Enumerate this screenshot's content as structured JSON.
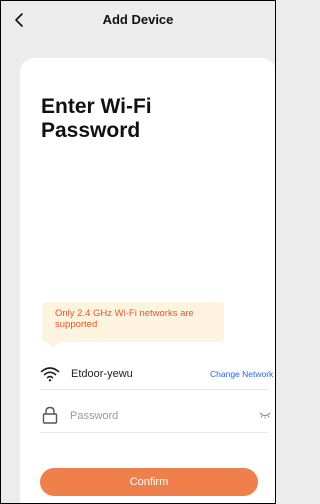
{
  "header": {
    "title": "Add Device",
    "back_icon": "chevron-left-icon"
  },
  "page": {
    "heading": "Enter Wi-Fi\nPassword"
  },
  "tooltip": {
    "text": "Only 2.4 GHz Wi-Fi networks are supported"
  },
  "wifi": {
    "icon": "wifi-icon",
    "network_name": "Etdoor-yewu",
    "change_label": "Change Network"
  },
  "password": {
    "icon": "lock-icon",
    "placeholder": "Password",
    "value": "",
    "toggle_icon": "eye-closed-icon"
  },
  "confirm": {
    "label": "Confirm"
  },
  "colors": {
    "background": "#ececec",
    "card": "#ffffff",
    "accent": "#ef7f4b",
    "link": "#2a64d8",
    "tooltip_bg": "#fdf3df",
    "tooltip_text": "#e0572a"
  }
}
